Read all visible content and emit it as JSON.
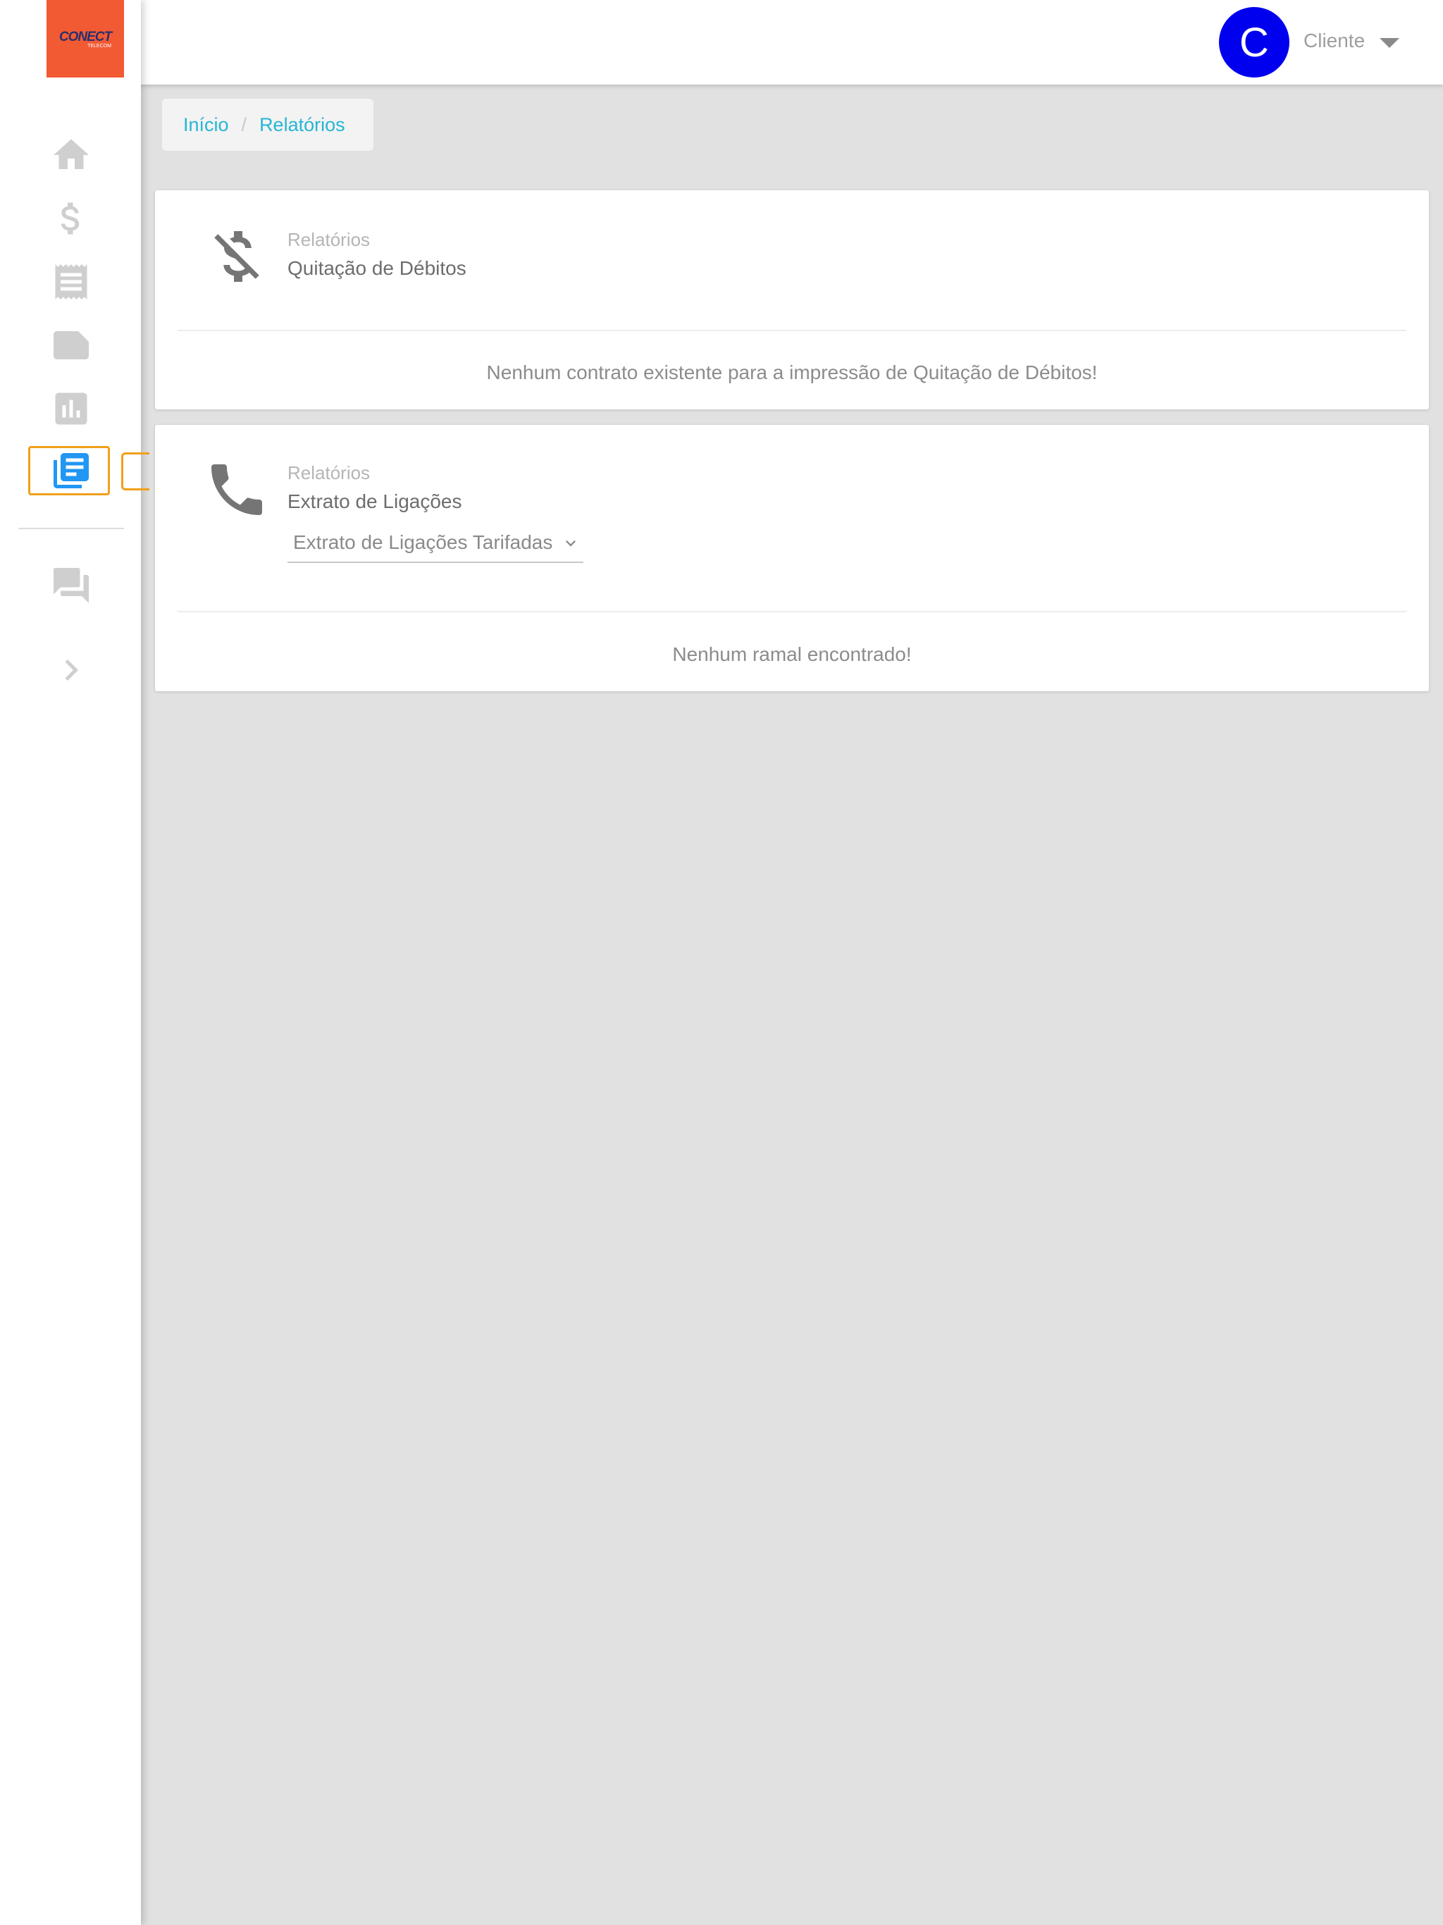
{
  "header": {
    "avatar_initial": "C",
    "user_name": "Cliente",
    "user_menu_icon": "caret-down-icon"
  },
  "sidebar": {
    "logo_text": "CONECT",
    "logo_subtext": "TELECOM",
    "items": [
      {
        "icon": "home-icon"
      },
      {
        "icon": "dollar-icon"
      },
      {
        "icon": "receipt-icon"
      },
      {
        "icon": "note-icon"
      },
      {
        "icon": "bar-chart-icon"
      },
      {
        "icon": "reports-icon",
        "active": true
      },
      {
        "icon": "forum-icon"
      },
      {
        "icon": "chevron-right-icon"
      }
    ],
    "active_color": "#2196f3",
    "highlight_color": "#f0a01a"
  },
  "breadcrumb": {
    "items": [
      "Início",
      "Relatórios"
    ],
    "separator": "/"
  },
  "cards": [
    {
      "icon": "money-off-icon",
      "subtitle": "Relatórios",
      "title": "Quitação de Débitos",
      "message": "Nenhum contrato existente para a impressão de Quitação de Débitos!"
    },
    {
      "icon": "phone-icon",
      "subtitle": "Relatórios",
      "title": "Extrato de Ligações",
      "select_value": "Extrato de Ligações Tarifadas",
      "message": "Nenhum ramal encontrado!"
    }
  ],
  "colors": {
    "logo_bg": "#f25a33",
    "avatar_bg": "#0000ee",
    "link": "#26b6d4",
    "background": "#e1e1e1"
  }
}
